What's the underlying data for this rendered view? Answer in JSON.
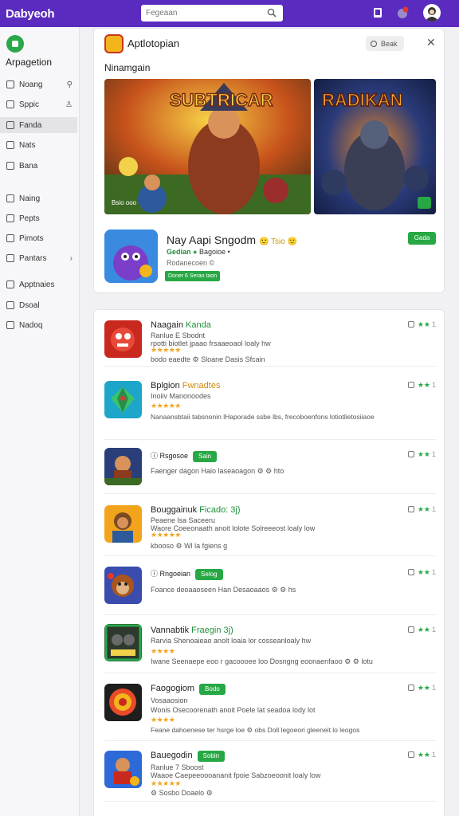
{
  "topbar": {
    "brand": "Dabyeoh",
    "search_placeholder": "Fegeaan",
    "accent_color": "#5b2bbf",
    "icons": [
      "search-icon",
      "tablet-icon",
      "notification-icon",
      "avatar"
    ]
  },
  "sidebar": {
    "title": "Arpagetion",
    "items": [
      {
        "label": "Noang",
        "right": "⚲"
      },
      {
        "label": "Sppic",
        "right": "♙"
      },
      {
        "label": "Fanda",
        "right": ""
      },
      {
        "label": "Nats",
        "right": ""
      },
      {
        "label": "Bana",
        "right": ""
      },
      {
        "label": "Naing",
        "right": ""
      },
      {
        "label": "Pepts",
        "right": ""
      },
      {
        "label": "Pimots",
        "right": ""
      },
      {
        "label": "Pantars",
        "right": "›"
      },
      {
        "label": "Apptnaies",
        "right": ""
      },
      {
        "label": "Dsoal",
        "right": ""
      },
      {
        "label": "Nadoq",
        "right": ""
      }
    ]
  },
  "featured": {
    "app_title": "Aptlotopian",
    "more_button": "Beak",
    "section_title": "Ninamgain",
    "banner1_text": "SUBTRICAR",
    "banner1_caption": "Bsio  ooo",
    "banner2_text": "RADIKAN",
    "app": {
      "name": "Nay Aapi Sngodm",
      "badge": "🙂 Tsio 🙂",
      "developer": "Gedian",
      "developer_suffix": "Bagoioe •",
      "meta": "Rodanecoen  ©",
      "tag": "Doner 6 Serao taon",
      "install": "Gada"
    }
  },
  "list": [
    {
      "name": "Naagain",
      "accent": "Kanda",
      "line1": "Ranlue  E  Sbodnt",
      "line2": "rpotti biotlet jpaao frsaaeoaol loaly  hw",
      "stars": "★★★★★",
      "line3": "bodo eaedte  ⚙ Sloane  Dasis  Sfcain",
      "rating": "★★",
      "num": "1",
      "tag": ""
    },
    {
      "name": "Bplgion",
      "accent": "Fwnadtes",
      "line1": "Inoiiv  Manonoodes",
      "line2": "",
      "stars": "★★★★★",
      "line3": "Nanaansbtaii tabsnonin lHaporade ssbe lbs, frecoboenfons lotiotlietosiiaoe",
      "rating": "★★",
      "num": "1",
      "tag": ""
    },
    {
      "name": "ⓘ Rsgosoe",
      "accent": "",
      "line1": "Faenger dagon  Haio laseaoagon ⚙ ⚙ hto",
      "line2": "",
      "stars": "",
      "line3": "",
      "rating": "★★",
      "num": "1",
      "tag": "Sain"
    },
    {
      "name": "Bouggainuk",
      "accent": "Ficado: 3j)",
      "line1": "Peaene  lsa  Saceeru",
      "line2": "Waore  Coeeonaath anoit lolote Solreeeost loaly  low",
      "stars": "★★★★★",
      "line3": "kbooso  ⚙ Wl  la fgiens  g",
      "rating": "★★",
      "num": "1",
      "tag": ""
    },
    {
      "name": "ⓘ Rngoeian",
      "accent": "",
      "line1": "Foance deoaaoseen  Han  Desaoaaos  ⚙ ⚙ hs",
      "line2": "",
      "stars": "",
      "line3": "",
      "rating": "★★",
      "num": "1",
      "tag": "Selog"
    },
    {
      "name": "Vannabtik",
      "accent": "Fraegin 3j)",
      "line1": "Rarvia  Shenoaieao anolt loaia lor cosseanloaly  hw",
      "line2": "",
      "stars": "★★★★",
      "line3": "Iwane Seenaepe eoo r gacoooee loo Dosngng  eoonaenfaoo  ⚙ ⚙ lotu",
      "rating": "★★",
      "num": "1",
      "tag": ""
    },
    {
      "name": "Faogogiom",
      "accent": "",
      "line1": "Vosaaosion",
      "line2": "Wonis  Osecoorenath anoit Poele lat seadoa lody  lot",
      "stars": "★★★★",
      "line3": "Feane  dahoenese ter hsrge loe ⚙ obs  Doll legoeori gleeneit  lo leogos",
      "rating": "★★",
      "num": "1",
      "tag": "Bodo"
    },
    {
      "name": "Bauegodin",
      "accent": "",
      "line1": "Ranlue  7  Sboost",
      "line2": "Waaoe  Caepeeoooananit fpoie Sabzoeoonit loaly  low",
      "stars": "★★★★★",
      "line3": "⚙  Sosbo  Doaelo  ⚙",
      "rating": "★★",
      "num": "1",
      "tag": "Sobin"
    }
  ]
}
